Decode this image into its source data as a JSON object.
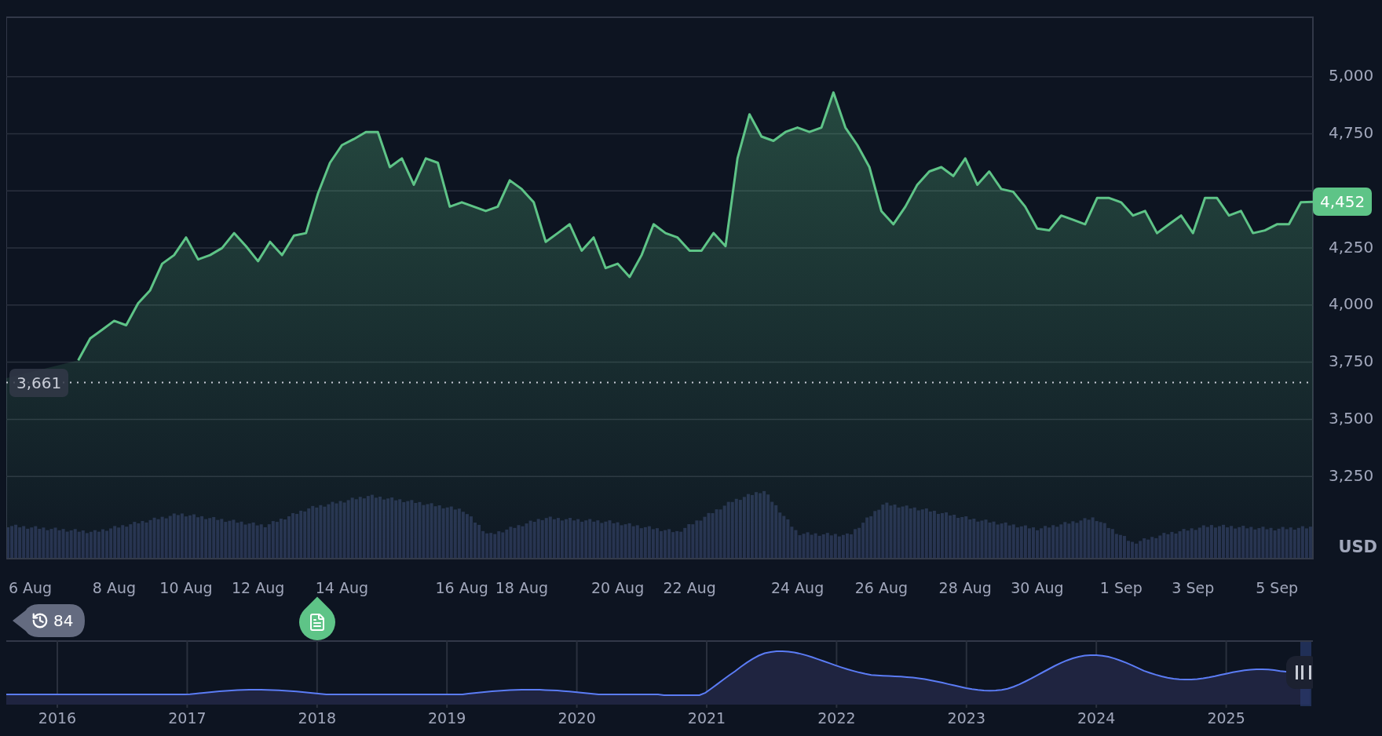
{
  "price_chart": {
    "chart_data": {
      "type": "area",
      "ylabel": "USD",
      "grid": true,
      "ylim": [
        2890,
        5260
      ],
      "yticks": [
        {
          "value": 3250,
          "label": "3,250"
        },
        {
          "value": 3500,
          "label": "3,500"
        },
        {
          "value": 3750,
          "label": "3,750"
        },
        {
          "value": 4000,
          "label": "4,000"
        },
        {
          "value": 4250,
          "label": "4,250"
        },
        {
          "value": 4750,
          "label": "4,750"
        },
        {
          "value": 5000,
          "label": "5,000"
        }
      ],
      "categories": [
        null,
        null,
        "6 Aug",
        null,
        null,
        null,
        null,
        null,
        null,
        "8 Aug",
        null,
        null,
        null,
        null,
        null,
        "10 Aug",
        null,
        null,
        null,
        null,
        null,
        "12 Aug",
        null,
        null,
        null,
        null,
        null,
        null,
        "14 Aug",
        null,
        null,
        null,
        null,
        null,
        null,
        null,
        null,
        null,
        "16 Aug",
        null,
        null,
        null,
        null,
        "18 Aug",
        null,
        null,
        null,
        null,
        null,
        null,
        null,
        "20 Aug",
        null,
        null,
        null,
        null,
        null,
        "22 Aug",
        null,
        null,
        null,
        null,
        null,
        null,
        null,
        null,
        "24 Aug",
        null,
        null,
        null,
        null,
        null,
        null,
        "26 Aug",
        null,
        null,
        null,
        null,
        null,
        null,
        "28 Aug",
        null,
        null,
        null,
        null,
        null,
        "30 Aug",
        null,
        null,
        null,
        null,
        null,
        null,
        "1 Sep",
        null,
        null,
        null,
        null,
        null,
        "3 Sep",
        null,
        null,
        null,
        null,
        null,
        null,
        "5 Sep",
        null,
        null,
        null
      ],
      "series": [
        {
          "color": "#5ec487",
          "values": [
            3680,
            null,
            null,
            null,
            null,
            null,
            3758,
            3854,
            3892,
            3931,
            3912,
            4008,
            4065,
            4181,
            4219,
            4296,
            4200,
            4219,
            4250,
            4315,
            4258,
            4192,
            4277,
            4219,
            4304,
            4315,
            4488,
            4623,
            4700,
            4727,
            4758,
            4758,
            4604,
            4642,
            4527,
            4642,
            4623,
            4431,
            4450,
            4431,
            4412,
            4431,
            4546,
            4508,
            4450,
            4277,
            4315,
            4354,
            4238,
            4296,
            4162,
            4181,
            4123,
            4219,
            4354,
            4315,
            4296,
            4238,
            4238,
            4315,
            4258,
            4642,
            4835,
            4738,
            4719,
            4758,
            4777,
            4758,
            4777,
            4931,
            4777,
            4700,
            4604,
            4412,
            4354,
            4431,
            4527,
            4585,
            4604,
            4565,
            4642,
            4527,
            4585,
            4508,
            4496,
            4431,
            4335,
            4327,
            4392,
            4373,
            4354,
            4469,
            4469,
            4450,
            4392,
            4412,
            4315,
            4354,
            4392,
            4315,
            4469,
            4469,
            4392,
            4412,
            4315,
            4327,
            4354,
            4354,
            4450,
            4452
          ]
        }
      ],
      "ref_lines": [
        {
          "axis": "y",
          "value": 3661,
          "label": "3,661"
        }
      ]
    },
    "price_tag": "4,452"
  },
  "markers": {
    "history": {
      "count": "84"
    },
    "news": {
      "kind": "news"
    }
  },
  "navigator": {
    "years": [
      "2016",
      "2017",
      "2018",
      "2019",
      "2020",
      "2021",
      "2022",
      "2023",
      "2024",
      "2025"
    ]
  }
}
